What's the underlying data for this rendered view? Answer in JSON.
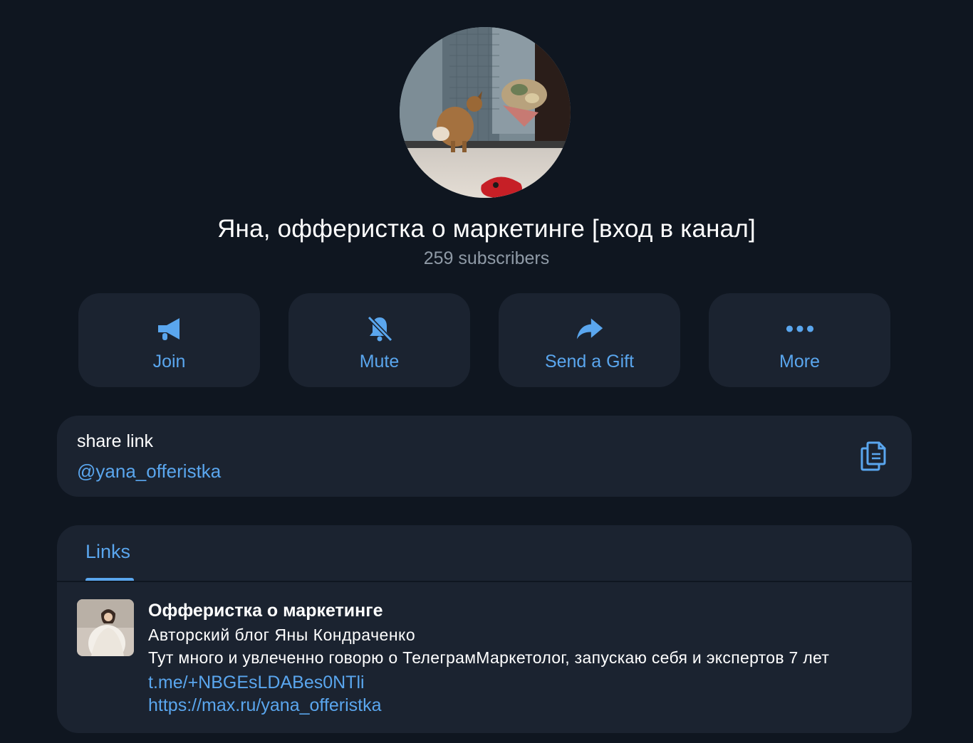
{
  "channel": {
    "title": "Яна, офферистка о маркетинге [вход в канал]",
    "subscribers": "259 subscribers",
    "avatar_icon": "channel-avatar-photo"
  },
  "actions": [
    {
      "label": "Join",
      "icon": "megaphone-icon"
    },
    {
      "label": "Mute",
      "icon": "bell-off-icon"
    },
    {
      "label": "Send a Gift",
      "icon": "forward-arrow-icon"
    },
    {
      "label": "More",
      "icon": "more-dots-icon"
    }
  ],
  "share": {
    "label": "share link",
    "handle": "@yana_offeristka",
    "icon": "copy-icon"
  },
  "links": {
    "tab_label": "Links",
    "items": [
      {
        "title": "Офферистка о маркетинге",
        "subtitle": "Авторский блог Яны Кондраченко",
        "description": "Тут много и увлеченно говорю о ТелеграмМаркетолог, запускаю себя и экспертов 7 лет",
        "url_1": "t.me/+NBGEsLDABes0NTli",
        "url_2": "https://max.ru/yana_offeristka"
      }
    ]
  },
  "colors": {
    "background": "#0f1620",
    "card": "#1b2330",
    "accent": "#5aa6ee",
    "muted_text": "#8f9aa6"
  }
}
